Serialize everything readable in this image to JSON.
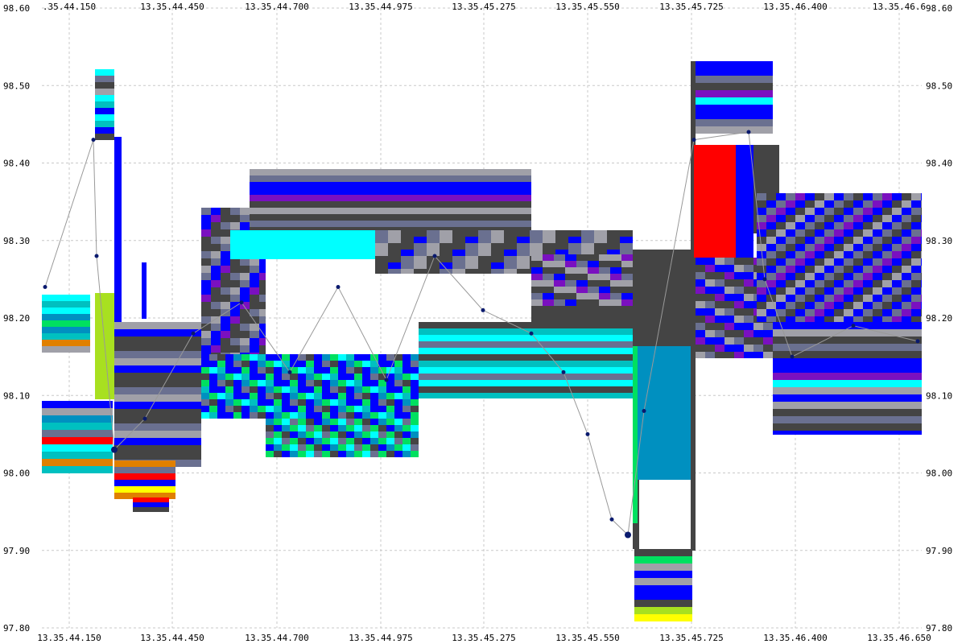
{
  "chart_data": {
    "type": "heatmap",
    "title": "",
    "xlabel": "",
    "ylabel": "",
    "ylim": [
      97.8,
      98.6
    ],
    "y_ticks": [
      "98.60",
      "98.50",
      "98.40",
      "98.30",
      "98.20",
      "98.10",
      "98.00",
      "97.90",
      "97.80"
    ],
    "x_ticks_top": [
      ".35.44.150",
      "13.35.44.450",
      "13.35.44.700",
      "13.35.44.975",
      "13.35.45.275",
      "13.35.45.550",
      "13.35.45.725",
      "13.35.46.400",
      "13.35.46.6"
    ],
    "x_ticks_bottom": [
      "13.35.44.150",
      "13.35.44.450",
      "13.35.44.700",
      "13.35.44.975",
      "13.35.45.275",
      "13.35.45.550",
      "13.35.45.725",
      "13.35.46.400",
      "13.35.46.650"
    ],
    "grid": true,
    "colors": {
      "background": "#ffffff",
      "grid": "#c8c8c8",
      "trade_line": "#999999",
      "trade_markers": "#0a1a6e",
      "depth_palette": [
        "#444444",
        "#6a7090",
        "#a0a0a8",
        "#0000ff",
        "#7a10c0",
        "#00ffff",
        "#00c0c0",
        "#0090c0",
        "#00e060",
        "#a8e020",
        "#ffff00",
        "#e08000",
        "#ff0000"
      ]
    },
    "trade_points": [
      {
        "x_index": 0,
        "y": 98.24
      },
      {
        "x_index": 1,
        "y": 98.43
      },
      {
        "x_index": 2,
        "y": 98.28
      },
      {
        "x_index": 3,
        "y": 98.03
      },
      {
        "x_index": 4,
        "y": 98.07
      },
      {
        "x_index": 5,
        "y": 98.18
      },
      {
        "x_index": 6,
        "y": 98.22
      },
      {
        "x_index": 7,
        "y": 98.13
      },
      {
        "x_index": 8,
        "y": 98.24
      },
      {
        "x_index": 9,
        "y": 98.12
      },
      {
        "x_index": 10,
        "y": 98.28
      },
      {
        "x_index": 11,
        "y": 98.21
      },
      {
        "x_index": 12,
        "y": 98.18
      },
      {
        "x_index": 13,
        "y": 98.13
      },
      {
        "x_index": 14,
        "y": 98.05
      },
      {
        "x_index": 15,
        "y": 97.94
      },
      {
        "x_index": 16,
        "y": 97.92
      },
      {
        "x_index": 17,
        "y": 98.08
      },
      {
        "x_index": 18,
        "y": 98.43
      },
      {
        "x_index": 19,
        "y": 98.44
      },
      {
        "x_index": 20,
        "y": 98.25
      },
      {
        "x_index": 21,
        "y": 98.15
      },
      {
        "x_index": 22,
        "y": 98.19
      },
      {
        "x_index": 23,
        "y": 98.17
      }
    ]
  }
}
